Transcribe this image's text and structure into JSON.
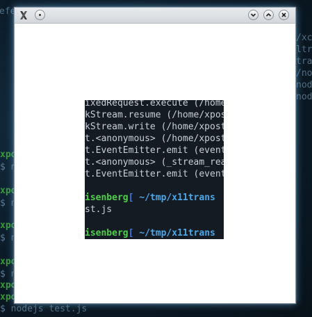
{
  "background_terminal": {
    "left_lines": [
      {
        "prefix": "xpo",
        "rest": ""
      },
      {
        "prefix": "$ ",
        "rest": "node"
      },
      {
        "prefix": "xpo",
        "rest": ""
      },
      {
        "prefix": "$ ",
        "rest": "node"
      },
      {
        "prefix": "xpo",
        "rest": ""
      },
      {
        "prefix": "$ ",
        "rest": "node"
      },
      {
        "prefix": "xpo",
        "rest": ""
      },
      {
        "prefix": "$ ",
        "rest": "node"
      },
      {
        "prefix": "xpo",
        "rest": ""
      },
      {
        "prefix": "$ ",
        "rest": "node"
      },
      {
        "prefix": "xpo",
        "rest": ""
      },
      {
        "prefix": "$ ",
        "rest": "nodejs test.js"
      }
    ],
    "top_fragment": "efe",
    "right_lines": [
      "/xc",
      "ltr",
      "tra",
      "/no",
      "nod",
      "nod"
    ]
  },
  "window": {
    "icon_name": "x11-icon",
    "buttons": {
      "minimize_icon": "minimize-icon",
      "maximize_icon": "maximize-icon",
      "close_icon": "close-icon"
    }
  },
  "inner_terminal": {
    "lines": [
      "ixedRequest.execute (/home",
      "kStream.resume (/home/xpos",
      "kStream.write (/home/xpost",
      "t.<anonymous> (/home/xpost",
      "t.EventEmitter.emit (event",
      "t.<anonymous> (_stream_rea",
      "t.EventEmitter.emit (event"
    ],
    "prompt1": {
      "user": "isenberg",
      "bracket": "[",
      "path": " ~/tmp/x11trans"
    },
    "command": "st.js",
    "prompt2": {
      "user": "isenberg",
      "bracket": "[",
      "path": " ~/tmp/x11trans"
    }
  },
  "colors": {
    "prompt_user": "#4dcf4a",
    "prompt_path": "#4aa7e8",
    "terminal_bg": "#151b22"
  }
}
